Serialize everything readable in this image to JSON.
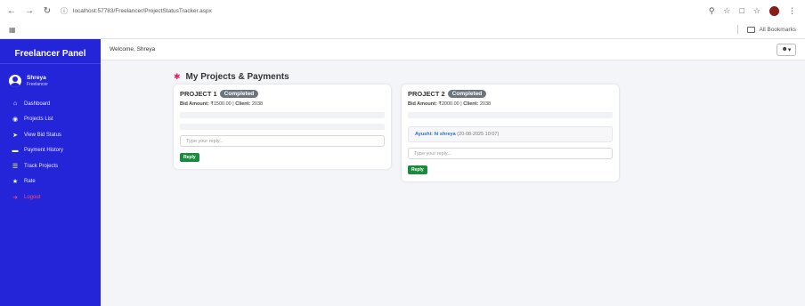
{
  "browser": {
    "url": "localhost:57783/Freelancer/ProjectStatusTracker.aspx",
    "bookmarks_label": "All Bookmarks"
  },
  "app": {
    "brand": "Freelancer Panel",
    "profile": {
      "name": "Shreya",
      "role": "Freelancer"
    },
    "menu": [
      {
        "icon": "home-icon",
        "label": "Dashboard"
      },
      {
        "icon": "eye-icon",
        "label": "Projects List"
      },
      {
        "icon": "paper-plane-icon",
        "label": "View Bid Status"
      },
      {
        "icon": "wallet-icon",
        "label": "Payment History"
      },
      {
        "icon": "list-icon",
        "label": "Track Projects"
      },
      {
        "icon": "star-icon",
        "label": "Rate"
      },
      {
        "icon": "logout-icon",
        "label": "Logout"
      }
    ],
    "welcome": "Welcome, Shreya"
  },
  "page": {
    "title": "My Projects & Payments",
    "projects": [
      {
        "title": "PROJECT 1",
        "status": "Completed",
        "bid_label": "Bid Amount:",
        "bid_amount": "₹1500.00",
        "client_label": "Client:",
        "client": "2038",
        "messages": [],
        "reply_placeholder": "Type your reply...",
        "reply_label": "Reply"
      },
      {
        "title": "PROJECT 2",
        "status": "Completed",
        "bid_label": "Bid Amount:",
        "bid_amount": "₹2000.00",
        "client_label": "Client:",
        "client": "2038",
        "messages": [
          {
            "author": "Ayushi: hi shreya",
            "time": "(20-08-2025 10:07)"
          }
        ],
        "reply_placeholder": "Type your reply...",
        "reply_label": "Reply"
      }
    ]
  },
  "colors": {
    "sidebar": "#2424d9",
    "badge": "#6c757d",
    "reply_button": "#1a8a3f",
    "logout": "#ff4d6a"
  }
}
